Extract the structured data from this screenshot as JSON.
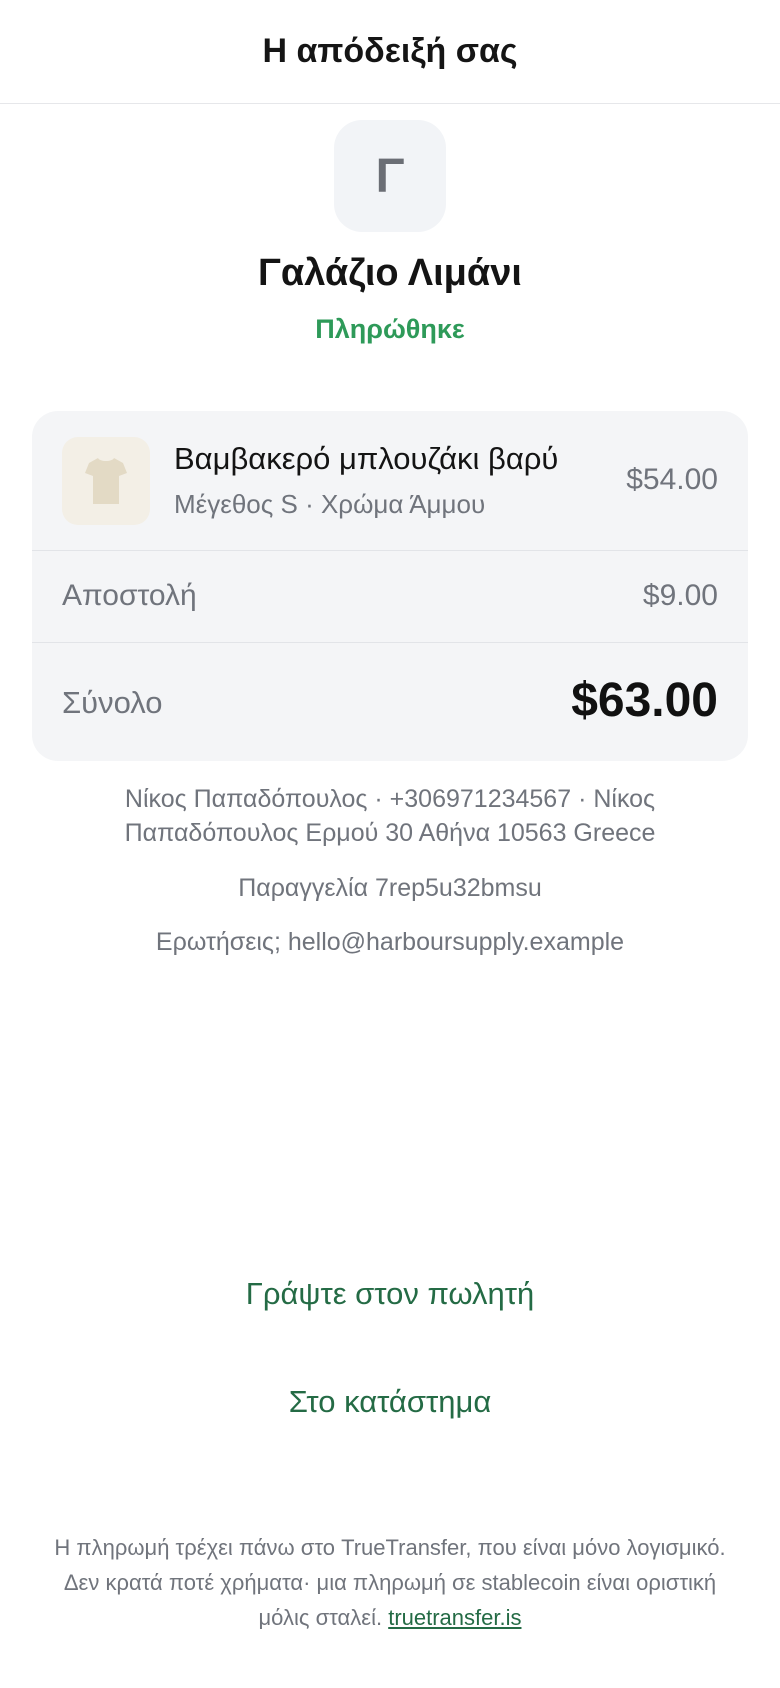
{
  "header": {
    "title": "Η απόδειξή σας"
  },
  "merchant": {
    "initial": "Γ",
    "name": "Γαλάζιο Λιμάνι",
    "status": "Πληρώθηκε"
  },
  "item": {
    "icon": "tshirt-icon",
    "name": "Βαμβακερό μπλουζάκι βαρύ",
    "meta": "Μέγεθος S · Χρώμα Άμμου",
    "price": "$54.00"
  },
  "shipping": {
    "label": "Αποστολή",
    "value": "$9.00"
  },
  "total": {
    "label": "Σύνολο",
    "value": "$63.00"
  },
  "customer": {
    "line1": "Νίκος Παπαδόπουλος · +306971234567 · Νίκος",
    "line2": "Παπαδόπουλος Ερμού 30 Αθήνα 10563 Greece"
  },
  "order": {
    "text": "Παραγγελία 7rep5u32bmsu"
  },
  "questions": {
    "text": "Ερωτήσεις; hello@harboursupply.example"
  },
  "actions": {
    "write_seller": "Γράψτε στον πωλητή",
    "to_store": "Στο κατάστημα"
  },
  "footer": {
    "text": "Η πληρωμή τρέχει πάνω στο TrueTransfer, που είναι μόνο λογισμικό. Δεν κρατά ποτέ χρήματα· μια πληρωμή σε stablecoin είναι οριστική μόλις σταλεί.",
    "link": "truetransfer.is"
  },
  "colors": {
    "paid_green": "#2e9a59",
    "link_green": "#246b45",
    "muted": "#70747c",
    "card_bg": "#f4f5f7"
  }
}
